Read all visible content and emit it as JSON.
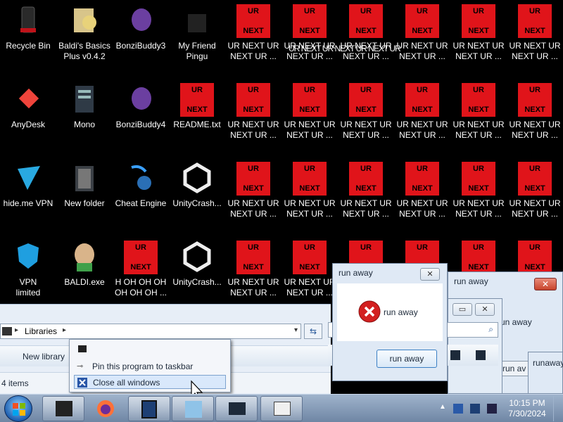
{
  "desktop": {
    "icons": [
      {
        "label": "Recycle Bin"
      },
      {
        "label": "Baldi's Basics\nPlus v0.4.2"
      },
      {
        "label": "BonziBuddy3"
      },
      {
        "label": "My Friend\nPingu"
      },
      {
        "label": "AnyDesk"
      },
      {
        "label": "Mono"
      },
      {
        "label": "BonziBuddy4"
      },
      {
        "label": "README.txt"
      },
      {
        "label": "hide.me VPN"
      },
      {
        "label": "New folder"
      },
      {
        "label": "Cheat Engine"
      },
      {
        "label": "UnityCrash..."
      },
      {
        "label": "VPN\nlimited"
      },
      {
        "label": "BALDI.exe"
      },
      {
        "label": "H OH OH OH\nOH OH OH ..."
      },
      {
        "label": "UnityCrash..."
      }
    ],
    "ur_tile": {
      "top": "UR",
      "bottom": "NEXT",
      "label": "UR NEXT UR\nNEXT UR ..."
    },
    "overlap_text": "UR NEXT UR NEXT UR NEXT UR"
  },
  "explorer": {
    "breadcrumb": "Libraries",
    "new_library": "New library",
    "status": "4 items"
  },
  "jumplist": {
    "pin": "Pin this program to taskbar",
    "close_all": "Close all windows"
  },
  "dialog1": {
    "title": "run away",
    "message": "run away",
    "button": "run away"
  },
  "dialog2": {
    "title": "run away",
    "message": "un away",
    "button": "run av"
  },
  "dialog3": {
    "title": "runaway"
  },
  "clock": {
    "time": "10:15 PM",
    "date": "7/30/2024"
  },
  "colors": {
    "ur_red": "#e0141a",
    "taskbar": "#6f86a4"
  }
}
